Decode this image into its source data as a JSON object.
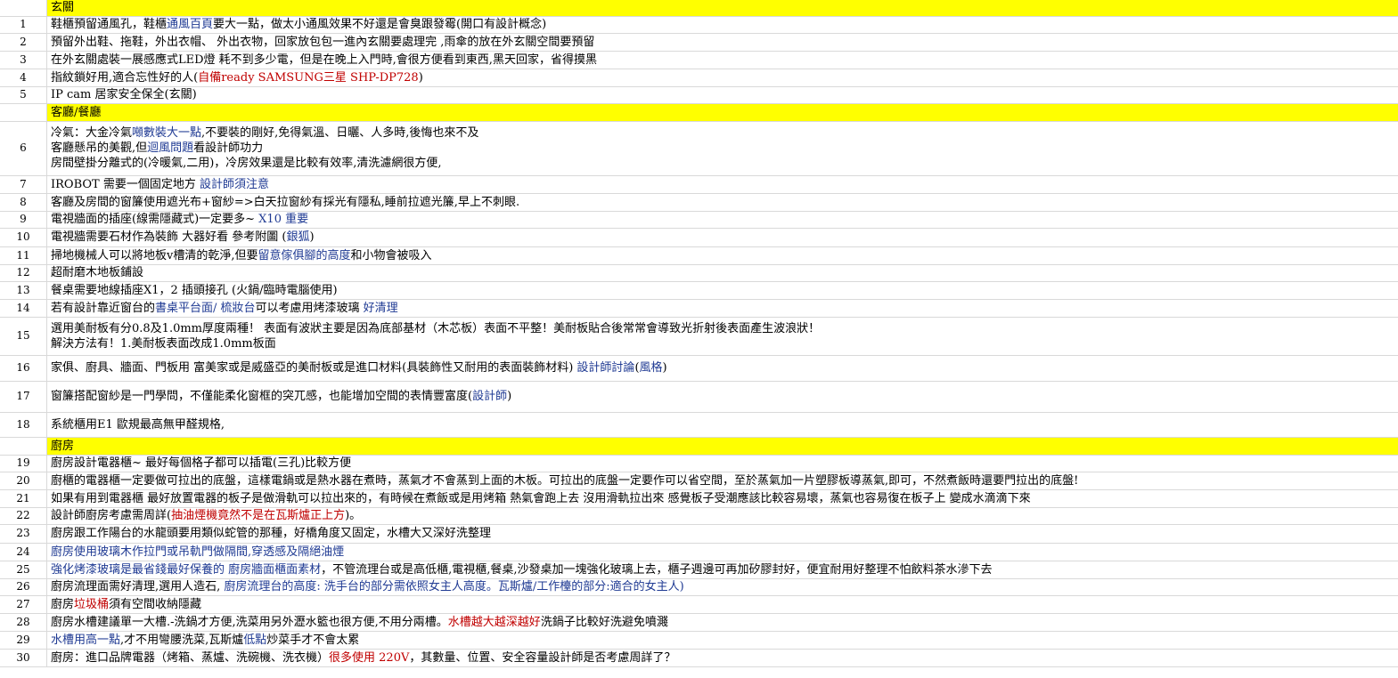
{
  "colors": {
    "section_bg": "#ffff00",
    "red": "#c00000",
    "blue": "#1f3a93",
    "grid": "#d9d9d9"
  },
  "rows": [
    {
      "type": "section",
      "num": "",
      "h": 18,
      "lines": [
        [
          [
            "玄關",
            ""
          ]
        ]
      ]
    },
    {
      "num": "1",
      "h": 19,
      "lines": [
        [
          [
            "鞋櫃預留通風孔，鞋櫃",
            ""
          ],
          [
            "通風百頁",
            "blue"
          ],
          [
            "要大一點，做太小通風效果不好還是會臭跟發霉(開口有設計概念)",
            ""
          ]
        ]
      ]
    },
    {
      "num": "2",
      "h": 20,
      "lines": [
        [
          [
            "預留外出鞋、拖鞋，外出衣帽、 外出衣物，回家放包包一進內玄關要處理完 ,雨傘的放在外玄關空間要預留",
            ""
          ]
        ]
      ]
    },
    {
      "num": "3",
      "h": 20,
      "lines": [
        [
          [
            "在外玄關處裝一展感應式LED燈 耗不到多少電，但是在晚上入門時,會很方便看到東西,黑天回家，省得摸黑",
            ""
          ]
        ]
      ]
    },
    {
      "num": "4",
      "h": 20,
      "lines": [
        [
          [
            "指紋鎖好用,適合忘性好的人(",
            ""
          ],
          [
            "自備ready SAMSUNG三星 SHP-DP728",
            "red"
          ],
          [
            ")",
            ""
          ]
        ]
      ]
    },
    {
      "num": "5",
      "h": 19,
      "lines": [
        [
          [
            "IP cam  居家安全保全(玄關)",
            ""
          ]
        ]
      ]
    },
    {
      "type": "section",
      "num": "",
      "h": 20,
      "lines": [
        [
          [
            "客廳/餐廳",
            ""
          ]
        ]
      ]
    },
    {
      "num": "6",
      "h": 61,
      "lines": [
        [
          [
            "冷氣：大金冷氣",
            ""
          ],
          [
            "噸數裝大一點",
            "blue"
          ],
          [
            ",不要裝的剛好,免得氣溫、日曬、人多時,後悔也來不及",
            ""
          ]
        ],
        [
          [
            "客廳懸吊的美觀,但",
            ""
          ],
          [
            "迴風問題",
            "blue"
          ],
          [
            "看設計師功力",
            ""
          ]
        ],
        [
          [
            "房間壁掛分離式的(冷暖氣,二用)，冷房效果還是比較有效率,清洗濾網很方便,",
            ""
          ]
        ]
      ]
    },
    {
      "num": "7",
      "h": 20,
      "lines": [
        [
          [
            "IROBOT 需要一個固定地方  ",
            ""
          ],
          [
            "設計師須注意",
            "blue"
          ]
        ]
      ]
    },
    {
      "num": "8",
      "h": 20,
      "lines": [
        [
          [
            "客廳及房間的窗簾使用遮光布+窗紗=>白天拉窗紗有採光有隱私,睡前拉遮光簾,早上不刺眼.",
            ""
          ]
        ]
      ]
    },
    {
      "num": "9",
      "h": 19,
      "lines": [
        [
          [
            "電視牆面的插座(線需隱藏式)一定要多~ ",
            ""
          ],
          [
            "X10 重要",
            "blue"
          ]
        ]
      ]
    },
    {
      "num": "10",
      "h": 21,
      "lines": [
        [
          [
            "電視牆需要石材作為裝飾 大器好看 參考附圖 (",
            ""
          ],
          [
            "銀狐",
            "blue"
          ],
          [
            ")",
            ""
          ]
        ]
      ]
    },
    {
      "num": "11",
      "h": 20,
      "lines": [
        [
          [
            "掃地機械人可以將地板v槽清的乾淨,但要",
            ""
          ],
          [
            "留意傢俱腳的高度",
            "blue"
          ],
          [
            "和小物會被吸入",
            ""
          ]
        ]
      ]
    },
    {
      "num": "12",
      "h": 19,
      "lines": [
        [
          [
            "超耐磨木地板鋪設",
            ""
          ]
        ]
      ]
    },
    {
      "num": "13",
      "h": 20,
      "lines": [
        [
          [
            "餐桌需要地線插座X1，2 插頭接孔 (火鍋/臨時電腦使用)",
            ""
          ]
        ]
      ]
    },
    {
      "num": "14",
      "h": 20,
      "lines": [
        [
          [
            "若有設計靠近窗台的",
            ""
          ],
          [
            "書桌平台面/ 梳妝台",
            "blue"
          ],
          [
            "可以考慮用烤漆玻璃 ",
            ""
          ],
          [
            "好清理",
            "blue"
          ]
        ]
      ]
    },
    {
      "num": "15",
      "h": 43,
      "lines": [
        [
          [
            " 選用美耐板有分0.8及1.0mm厚度兩種！ 表面有波狀主要是因為底部基材（木芯板）表面不平整！美耐板貼合後常常會導致光折射後表面產生波浪狀！",
            ""
          ]
        ],
        [
          [
            "解決方法有！1.美耐板表面改成1.0mm板面",
            ""
          ]
        ]
      ]
    },
    {
      "num": "16",
      "h": 29,
      "lines": [
        [
          [
            "家俱、廚具、牆面、門板用 富美家或是威盛亞的美耐板或是進口材料(具裝飾性又耐用的表面裝飾材料)  ",
            ""
          ],
          [
            "設計師討論",
            "blue"
          ],
          [
            "(",
            ""
          ],
          [
            "風格",
            "blue"
          ],
          [
            ")",
            ""
          ]
        ]
      ]
    },
    {
      "num": "17",
      "h": 35,
      "lines": [
        [
          [
            "窗簾搭配窗紗是一門學問，不僅能柔化窗框的突兀感，也能增加空間的表情豐富度(",
            ""
          ],
          [
            "設計師",
            "blue"
          ],
          [
            ")",
            ""
          ]
        ]
      ]
    },
    {
      "num": "18",
      "h": 28,
      "lines": [
        [
          [
            "系統櫃用E1 歐規最高無甲醛規格,",
            ""
          ]
        ]
      ]
    },
    {
      "type": "section",
      "num": "",
      "h": 20,
      "lines": [
        [
          [
            "廚房",
            ""
          ]
        ]
      ]
    },
    {
      "num": "19",
      "h": 19,
      "lines": [
        [
          [
            "廚房設計電器櫃~ 最好每個格子都可以插電(三孔)比較方便",
            ""
          ]
        ]
      ]
    },
    {
      "num": "20",
      "h": 20,
      "lines": [
        [
          [
            "廚櫃的電器櫃一定要做可拉出的底盤，這樣電鍋或是熱水器在煮時，蒸氣才不會蒸到上面的木板。可拉出的底盤一定要作可以省空間，至於蒸氣加一片塑膠板導蒸氣,即可，不然煮飯時還要門拉出的底盤!",
            ""
          ]
        ]
      ]
    },
    {
      "num": "21",
      "h": 20,
      "lines": [
        [
          [
            "如果有用到電器櫃 最好放置電器的板子是做滑軌可以拉出來的，有時候在煮飯或是用烤箱 熱氣會跑上去 沒用滑軌拉出來 感覺板子受潮應該比較容易壞，蒸氣也容易復在板子上 變成水滴滴下來",
            ""
          ]
        ]
      ]
    },
    {
      "num": "22",
      "h": 19,
      "lines": [
        [
          [
            "設計師廚房考慮需周詳(",
            ""
          ],
          [
            "抽油煙機竟然不是在瓦斯爐正上方",
            "red"
          ],
          [
            ")。",
            ""
          ]
        ]
      ]
    },
    {
      "num": "23",
      "h": 21,
      "lines": [
        [
          [
            " 廚房跟工作陽台的水龍頭要用類似蛇管的那種，好橋角度又固定，水槽大又深好洗整理",
            ""
          ]
        ]
      ]
    },
    {
      "num": "24",
      "h": 20,
      "lines": [
        [
          [
            " ",
            ""
          ],
          [
            "廚房使用玻璃木作拉門或吊軌門做隔間,穿透感及隔絕油煙",
            "blue"
          ]
        ]
      ]
    },
    {
      "num": "25",
      "h": 20,
      "lines": [
        [
          [
            "強化烤漆玻璃是最省錢最好保養的 廚房牆面櫃面素材",
            "blue"
          ],
          [
            "，不管流理台或是高低櫃,電視櫃,餐桌,沙發桌加一塊強化玻璃上去，櫃子週邊可再加矽膠封好，便宜耐用好整理不怕飲料茶水滲下去",
            ""
          ]
        ]
      ]
    },
    {
      "num": "26",
      "h": 19,
      "lines": [
        [
          [
            " 廚房流理面需好清理,選用人造石, ",
            ""
          ],
          [
            "廚房流理台的高度: 洗手台的部分需依照女主人高度。瓦斯爐/工作檯的部分:適合的女主人)",
            "blue"
          ]
        ]
      ]
    },
    {
      "num": "27",
      "h": 20,
      "lines": [
        [
          [
            "廚房",
            ""
          ],
          [
            "垃圾桶",
            "red"
          ],
          [
            "須有空間收納隱藏",
            ""
          ]
        ]
      ]
    },
    {
      "num": "28",
      "h": 20,
      "lines": [
        [
          [
            "廚房水槽建議單一大槽.-洗鍋才方便,洗菜用另外瀝水籃也很方便,不用分兩槽。",
            ""
          ],
          [
            "水槽越大越深越好",
            "red"
          ],
          [
            "洗鍋子比較好洗避免噴濺",
            ""
          ]
        ]
      ]
    },
    {
      "num": "29",
      "h": 20,
      "lines": [
        [
          [
            "水槽用高一點",
            "blue"
          ],
          [
            ",才不用彎腰洗菜,瓦斯爐",
            ""
          ],
          [
            "低點",
            "blue"
          ],
          [
            "炒菜手才不會太累",
            ""
          ]
        ]
      ]
    },
    {
      "num": "30",
      "h": 20,
      "lines": [
        [
          [
            "廚房：進口品牌電器（烤箱、蒸爐、洗碗機、洗衣機）",
            ""
          ],
          [
            "很多使用 220V",
            "red"
          ],
          [
            "，其數量、位置、安全容量設計師是否考慮周詳了？",
            ""
          ]
        ]
      ]
    }
  ]
}
